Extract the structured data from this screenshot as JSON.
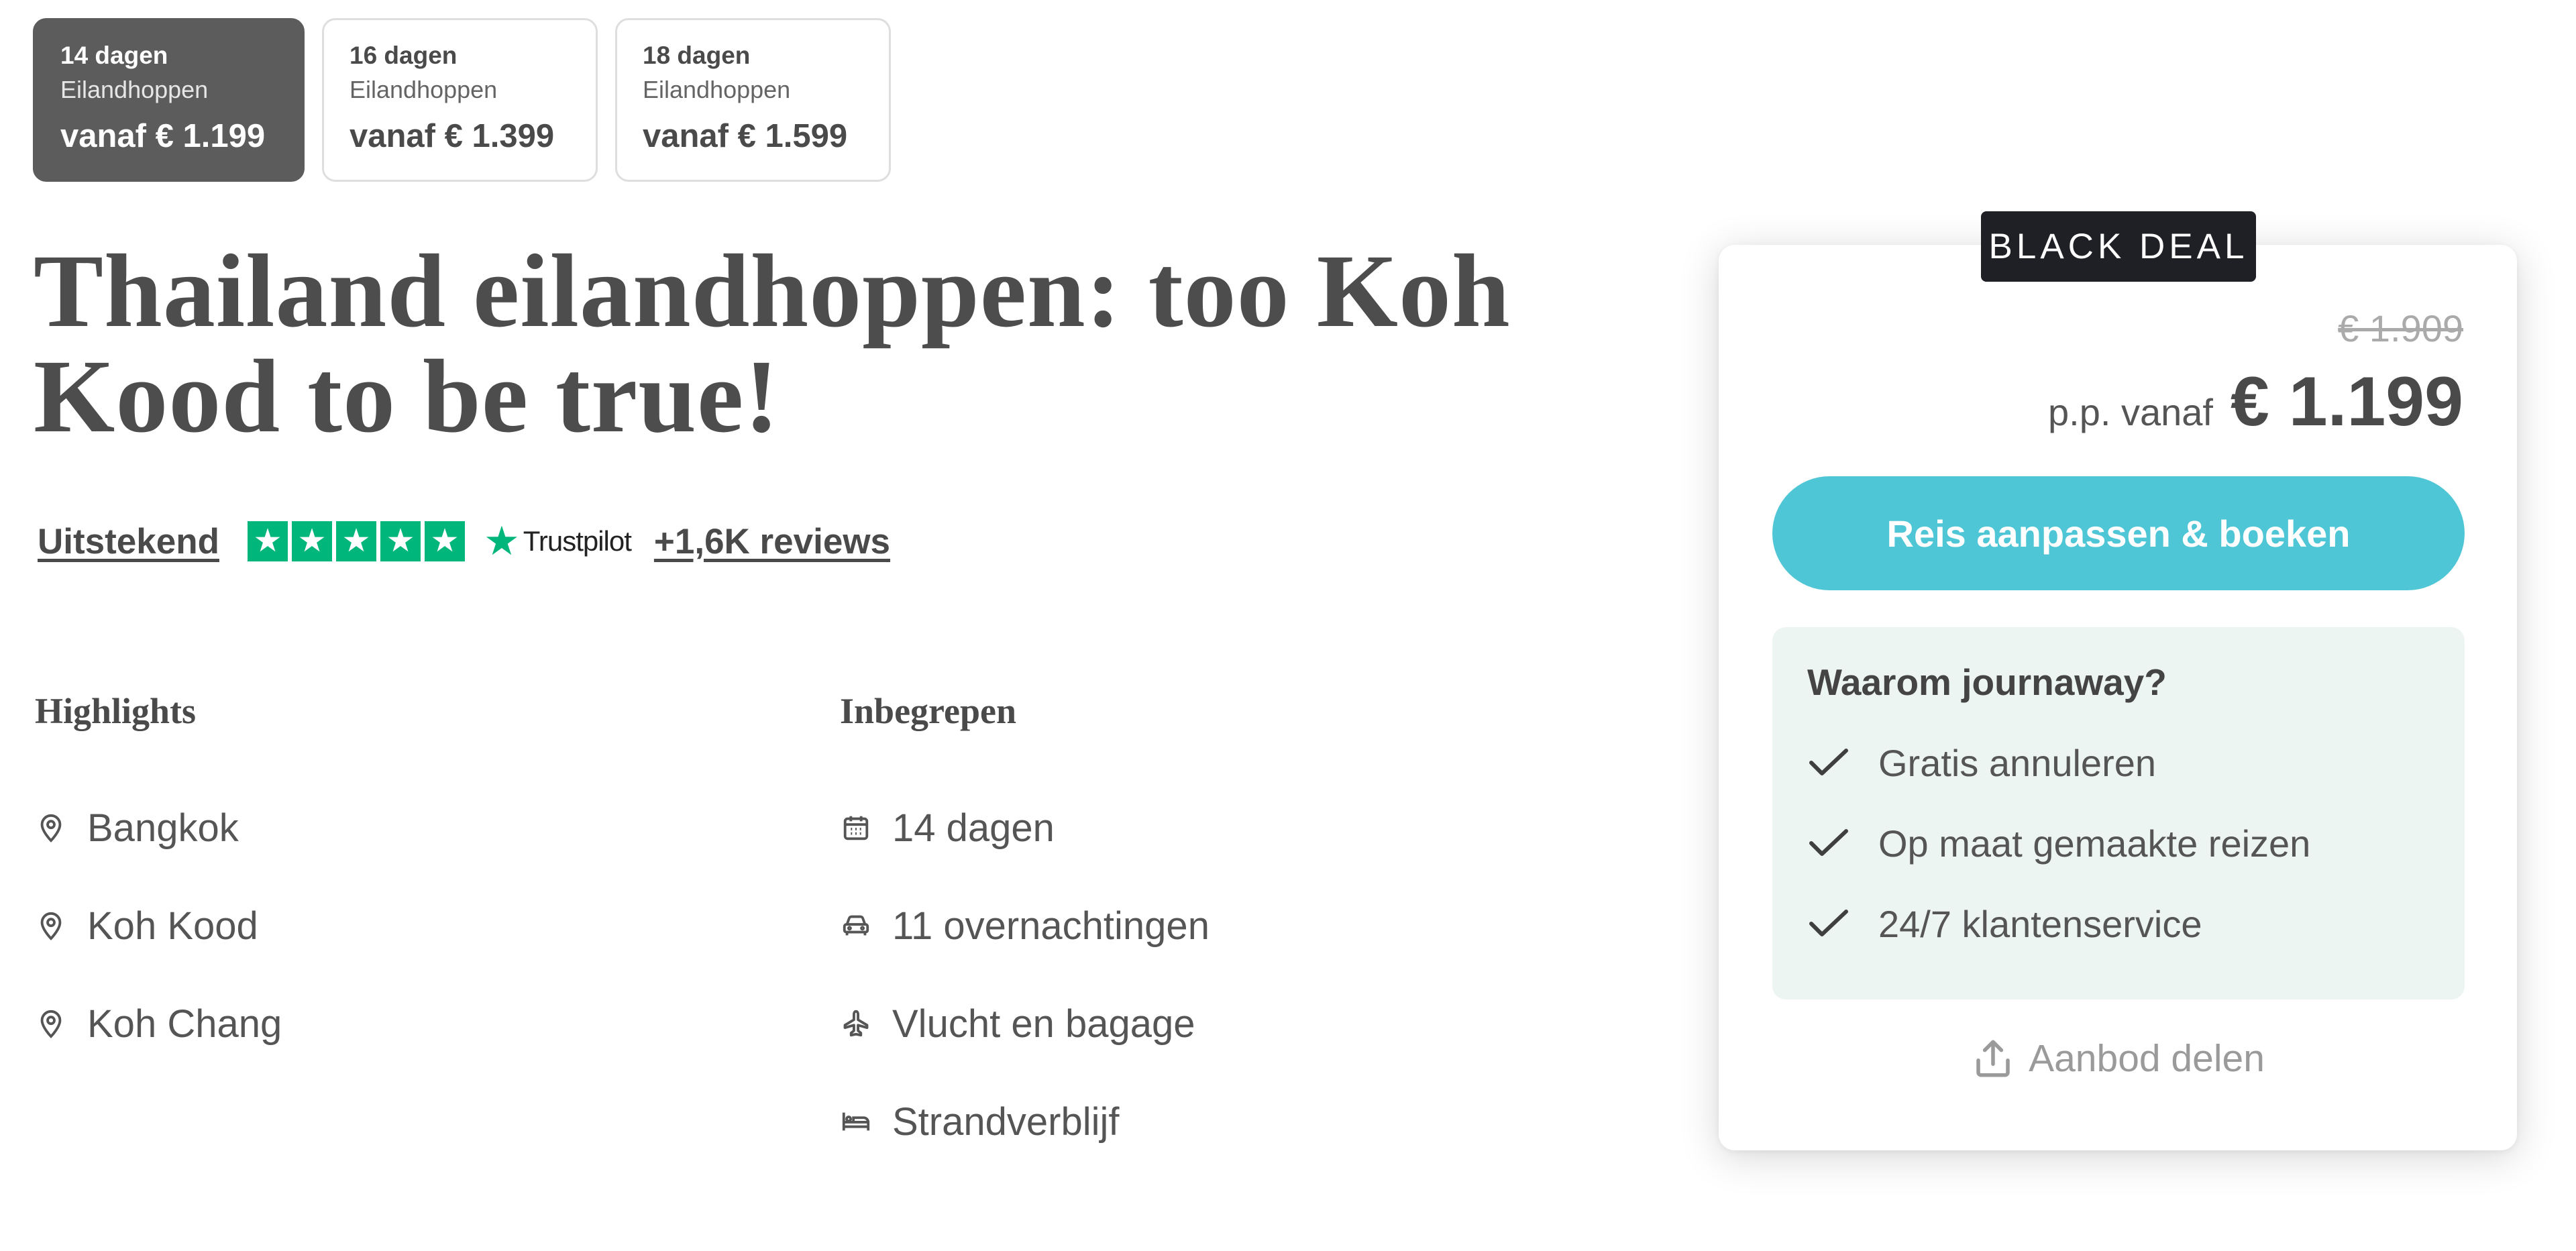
{
  "options": [
    {
      "days": "14 dagen",
      "type": "Eilandhoppen",
      "price": "vanaf € 1.199",
      "selected": true
    },
    {
      "days": "16 dagen",
      "type": "Eilandhoppen",
      "price": "vanaf € 1.399",
      "selected": false
    },
    {
      "days": "18 dagen",
      "type": "Eilandhoppen",
      "price": "vanaf € 1.599",
      "selected": false
    }
  ],
  "title": "Thailand eilandhoppen: too Koh Kood to be true!",
  "rating": {
    "label": "Uitstekend",
    "stars": 5,
    "provider": "Trustpilot",
    "reviews": "+1,6K reviews",
    "star_color": "#00b67a"
  },
  "highlights": {
    "heading": "Highlights",
    "items": [
      {
        "icon": "map-pin-icon",
        "label": "Bangkok"
      },
      {
        "icon": "map-pin-icon",
        "label": "Koh Kood"
      },
      {
        "icon": "map-pin-icon",
        "label": "Koh Chang"
      }
    ]
  },
  "included": {
    "heading": "Inbegrepen",
    "items": [
      {
        "icon": "calendar-icon",
        "label": "14 dagen"
      },
      {
        "icon": "car-icon",
        "label": "11 overnachtingen"
      },
      {
        "icon": "plane-icon",
        "label": "Vlucht en bagage"
      },
      {
        "icon": "bed-icon",
        "label": "Strandverblijf"
      }
    ]
  },
  "booking": {
    "badge": "BLACK DEAL",
    "old_price": "€ 1.909",
    "price_prefix": "p.p. vanaf",
    "price": "€ 1.199",
    "cta": "Reis aanpassen & boeken",
    "why_title": "Waarom journaway?",
    "benefits": [
      "Gratis annuleren",
      "Op maat gemaakte reizen",
      "24/7 klantenservice"
    ],
    "share": "Aanbod delen",
    "accent": "#4fc6d6"
  }
}
